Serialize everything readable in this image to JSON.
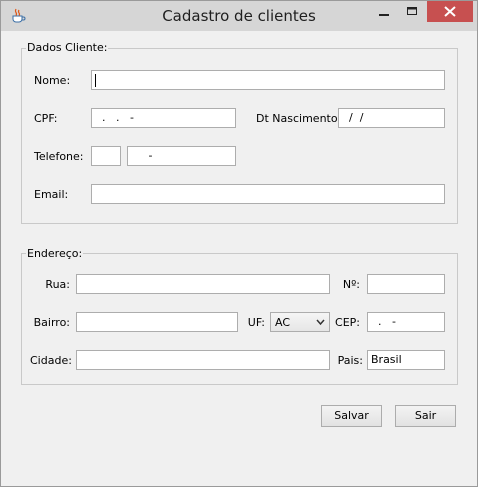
{
  "window": {
    "title": "Cadastro de clientes"
  },
  "dados": {
    "legend": "Dados Cliente:",
    "nome_label": "Nome:",
    "nome_value": "",
    "cpf_label": "CPF:",
    "cpf_value": "  .   .   -",
    "dtnasc_label": "Dt Nascimento.:",
    "dtnasc_value": "  /  /",
    "telefone_label": "Telefone:",
    "ddd_value": "",
    "telefone_value": "     -",
    "email_label": "Email:",
    "email_value": ""
  },
  "endereco": {
    "legend": "Endereço:",
    "rua_label": "Rua:",
    "rua_value": "",
    "numero_label": "Nº:",
    "numero_value": "",
    "bairro_label": "Bairro:",
    "bairro_value": "",
    "uf_label": "UF:",
    "uf_value": "AC",
    "cep_label": "CEP:",
    "cep_value": "  .   -",
    "cidade_label": "Cidade:",
    "cidade_value": "",
    "pais_label": "Pais:",
    "pais_value": "Brasil"
  },
  "buttons": {
    "salvar": "Salvar",
    "sair": "Sair"
  },
  "colors": {
    "titlebar": "#d6d6d6",
    "close": "#c75050",
    "background": "#f0f0f0"
  }
}
